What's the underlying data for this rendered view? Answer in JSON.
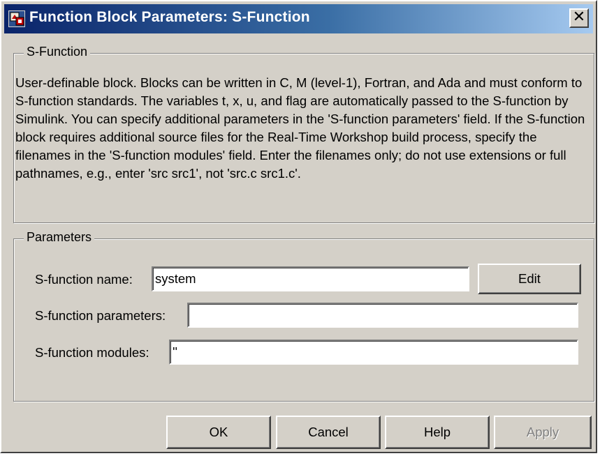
{
  "window": {
    "title": "Function Block Parameters: S-Function",
    "close_label": "X",
    "app_icon": "simulink-block-icon"
  },
  "description_group": {
    "legend": "S-Function",
    "text": "User-definable block.  Blocks can be written in C, M (level-1), Fortran, and Ada and must conform to S-function standards.  The variables t, x, u, and flag are automatically passed to the S-function by Simulink.  You can specify additional parameters in the 'S-function parameters' field. If the S-function block requires additional source files for the Real-Time Workshop build process, specify the filenames in the 'S-function modules' field. Enter the filenames only; do not use extensions or full pathnames, e.g., enter 'src src1', not 'src.c src1.c'."
  },
  "parameters_group": {
    "legend": "Parameters",
    "fields": [
      {
        "label": "S-function name:",
        "value": "system"
      },
      {
        "label": "S-function parameters:",
        "value": ""
      },
      {
        "label": "S-function modules:",
        "value": "''"
      }
    ],
    "edit_button": "Edit"
  },
  "buttons": {
    "ok": "OK",
    "cancel": "Cancel",
    "help": "Help",
    "apply": "Apply"
  },
  "colors": {
    "dialog_bg": "#d4d0c8",
    "titlebar_start": "#0a246a",
    "titlebar_end": "#a6caf0"
  }
}
